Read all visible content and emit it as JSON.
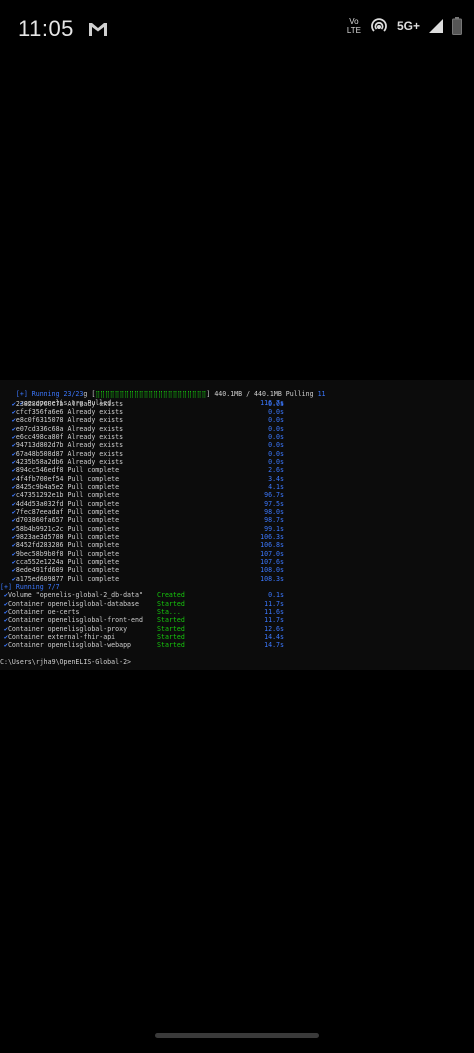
{
  "status_bar": {
    "time": "11:05",
    "volte_line1": "Vo",
    "volte_line2": "LTE",
    "network": "5G+",
    "icons": [
      "gmail-icon",
      "hotspot-icon",
      "signal-icon",
      "battery-icon"
    ]
  },
  "terminal": {
    "header": {
      "prefix": "[+] Running 23/23",
      "mid": "g [",
      "bar": "⣿⣿⣿⣿⣿⣿⣿⣿⣿⣿⣿⣿⣿⣿⣿⣿⣿⣿⣿⣿⣿⣿⣿",
      "after": "] 440.1MB / 440.1MB Pulling",
      "tail": "11"
    },
    "pull_root": {
      "label": "oe.openelis.org Pulled",
      "time": "116.7s"
    },
    "layers": [
      {
        "id": "23828d760c7b",
        "status": "Already exists",
        "time": "0.0s"
      },
      {
        "id": "cfcf356fa6e6",
        "status": "Already exists",
        "time": "0.0s"
      },
      {
        "id": "e8c0f6315078",
        "status": "Already exists",
        "time": "0.0s"
      },
      {
        "id": "e07cd336c68a",
        "status": "Already exists",
        "time": "0.0s"
      },
      {
        "id": "e6cc498ca80f",
        "status": "Already exists",
        "time": "0.0s"
      },
      {
        "id": "94713d802d7b",
        "status": "Already exists",
        "time": "0.0s"
      },
      {
        "id": "67a48b508d87",
        "status": "Already exists",
        "time": "0.0s"
      },
      {
        "id": "4235b58a2db6",
        "status": "Already exists",
        "time": "0.0s"
      },
      {
        "id": "894cc546edf8",
        "status": "Pull complete",
        "time": "2.6s"
      },
      {
        "id": "4f4fb700ef54",
        "status": "Pull complete",
        "time": "3.4s"
      },
      {
        "id": "8425c9b4a5e2",
        "status": "Pull complete",
        "time": "4.1s"
      },
      {
        "id": "c47351292e1b",
        "status": "Pull complete",
        "time": "96.7s"
      },
      {
        "id": "4d4d53a032fd",
        "status": "Pull complete",
        "time": "97.5s"
      },
      {
        "id": "7fec87eeadaf",
        "status": "Pull complete",
        "time": "98.0s"
      },
      {
        "id": "d703860fa657",
        "status": "Pull complete",
        "time": "98.7s"
      },
      {
        "id": "58b4b9921c2c",
        "status": "Pull complete",
        "time": "99.1s"
      },
      {
        "id": "9823ae3d5780",
        "status": "Pull complete",
        "time": "106.3s"
      },
      {
        "id": "8452fd283286",
        "status": "Pull complete",
        "time": "106.8s"
      },
      {
        "id": "9bec58b9b0f8",
        "status": "Pull complete",
        "time": "107.0s"
      },
      {
        "id": "cca552e1224a",
        "status": "Pull complete",
        "time": "107.6s"
      },
      {
        "id": "8ede491fd609",
        "status": "Pull complete",
        "time": "108.0s"
      },
      {
        "id": "a175ed609877",
        "status": "Pull complete",
        "time": "108.3s"
      }
    ],
    "running_header": "[+] Running 7/7",
    "resources": [
      {
        "name": "Volume \"openelis-global-2_db-data\"",
        "status": "Created",
        "time": "0.1s"
      },
      {
        "name": "Container openelisglobal-database",
        "status": "Started",
        "time": "11.7s"
      },
      {
        "name": "Container oe-certs",
        "status": "Sta...",
        "time": "11.6s"
      },
      {
        "name": "Container openelisglobal-front-end",
        "status": "Started",
        "time": "11.7s"
      },
      {
        "name": "Container openelisglobal-proxy",
        "status": "Started",
        "time": "12.6s"
      },
      {
        "name": "Container external-fhir-api",
        "status": "Started",
        "time": "14.4s"
      },
      {
        "name": "Container openelisglobal-webapp",
        "status": "Started",
        "time": "14.7s"
      }
    ],
    "prompt": "C:\\Users\\rjha9\\OpenELIS-Global-2>"
  },
  "colors": {
    "background": "#000000",
    "terminal_bg": "#0c0c0c",
    "blue": "#3b78ff",
    "green": "#16c60c",
    "text": "#cfcfcf"
  }
}
